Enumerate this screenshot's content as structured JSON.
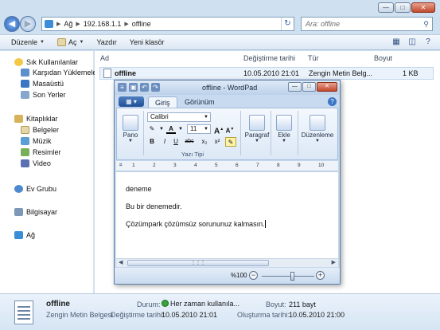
{
  "explorer": {
    "address": {
      "segments": [
        "Ağ",
        "192.168.1.1",
        "offline"
      ]
    },
    "search": {
      "placeholder": "Ara: offline"
    },
    "commands": {
      "organize": "Düzenle",
      "open": "Aç",
      "print": "Yazdır",
      "new_folder": "Yeni klasör"
    },
    "nav": {
      "favorites": "Sık Kullanılanlar",
      "downloads": "Karşıdan Yüklemeler",
      "desktop": "Masaüstü",
      "recent": "Son Yerler",
      "libraries": "Kitaplıklar",
      "documents": "Belgeler",
      "music": "Müzik",
      "pictures": "Resimler",
      "videos": "Video",
      "homegroup": "Ev Grubu",
      "computer": "Bilgisayar",
      "network": "Ağ"
    },
    "columns": {
      "name": "Ad",
      "modified": "Değiştirme tarihi",
      "type": "Tür",
      "size": "Boyut"
    },
    "files": [
      {
        "name": "offline",
        "modified": "10.05.2010 21:01",
        "type": "Zengin Metin Belg...",
        "size": "1 KB"
      }
    ],
    "details": {
      "name": "offline",
      "type": "Zengin Metin Belgesi",
      "status_label": "Durum:",
      "status_value": "Her zaman kullanıla...",
      "modified_label": "Değiştirme tarihi:",
      "modified_value": "10.05.2010 21:01",
      "size_label": "Boyut:",
      "size_value": "211 bayt",
      "created_label": "Oluşturma tarihi:",
      "created_value": "10.05.2010 21:00"
    }
  },
  "wordpad": {
    "title": "offline - WordPad",
    "tabs": {
      "home": "Giriş",
      "view": "Görünüm"
    },
    "ribbon": {
      "paste": "Pano",
      "font_name": "Calibri",
      "font_size": "11",
      "font_group": "Yazı Tipi",
      "paragraph": "Paragraf",
      "insert": "Ekle",
      "editing": "Düzenleme",
      "bold": "B",
      "italic": "I",
      "underline": "U",
      "strike": "abc",
      "subscript": "x₂",
      "superscript": "x²"
    },
    "ruler_marks": [
      "1",
      "2",
      "3",
      "4",
      "5",
      "6",
      "7",
      "8",
      "9",
      "10"
    ],
    "document": {
      "lines": [
        "deneme",
        "Bu bir denemedir.",
        "Çözümpark çözümsüz sorununuz kalmasın."
      ]
    },
    "status": {
      "zoom": "%100",
      "zoom_level_percent": 100
    }
  }
}
